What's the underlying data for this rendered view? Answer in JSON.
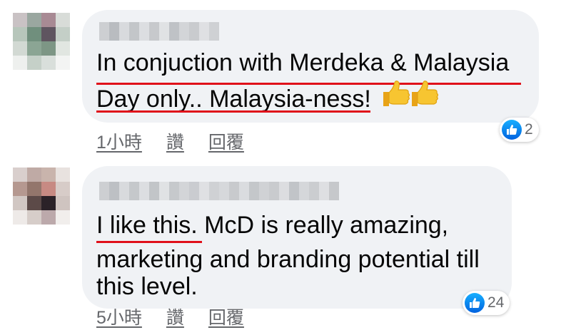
{
  "comments": [
    {
      "text_line1": "In conjuction with Merdeka & Malaysia",
      "text_line2": "Day only.. Malaysia-ness!",
      "time": "1小時",
      "like_label": "讚",
      "reply_label": "回覆",
      "reaction_count": "2"
    },
    {
      "text_line1": "I like this. McD is really amazing,",
      "text_line2": "marketing and branding potential till",
      "text_line3": "this level.",
      "time": "5小時",
      "like_label": "讚",
      "reply_label": "回覆",
      "reaction_count": "24"
    }
  ],
  "icons": {
    "reaction": "like-thumb-icon",
    "emoji": "thumbs-up-emoji-icon"
  },
  "colors": {
    "bubble": "#f0f2f5",
    "annotation_underline": "#e0101a",
    "like_blue": "#1877f2",
    "meta_text": "#65676b"
  }
}
